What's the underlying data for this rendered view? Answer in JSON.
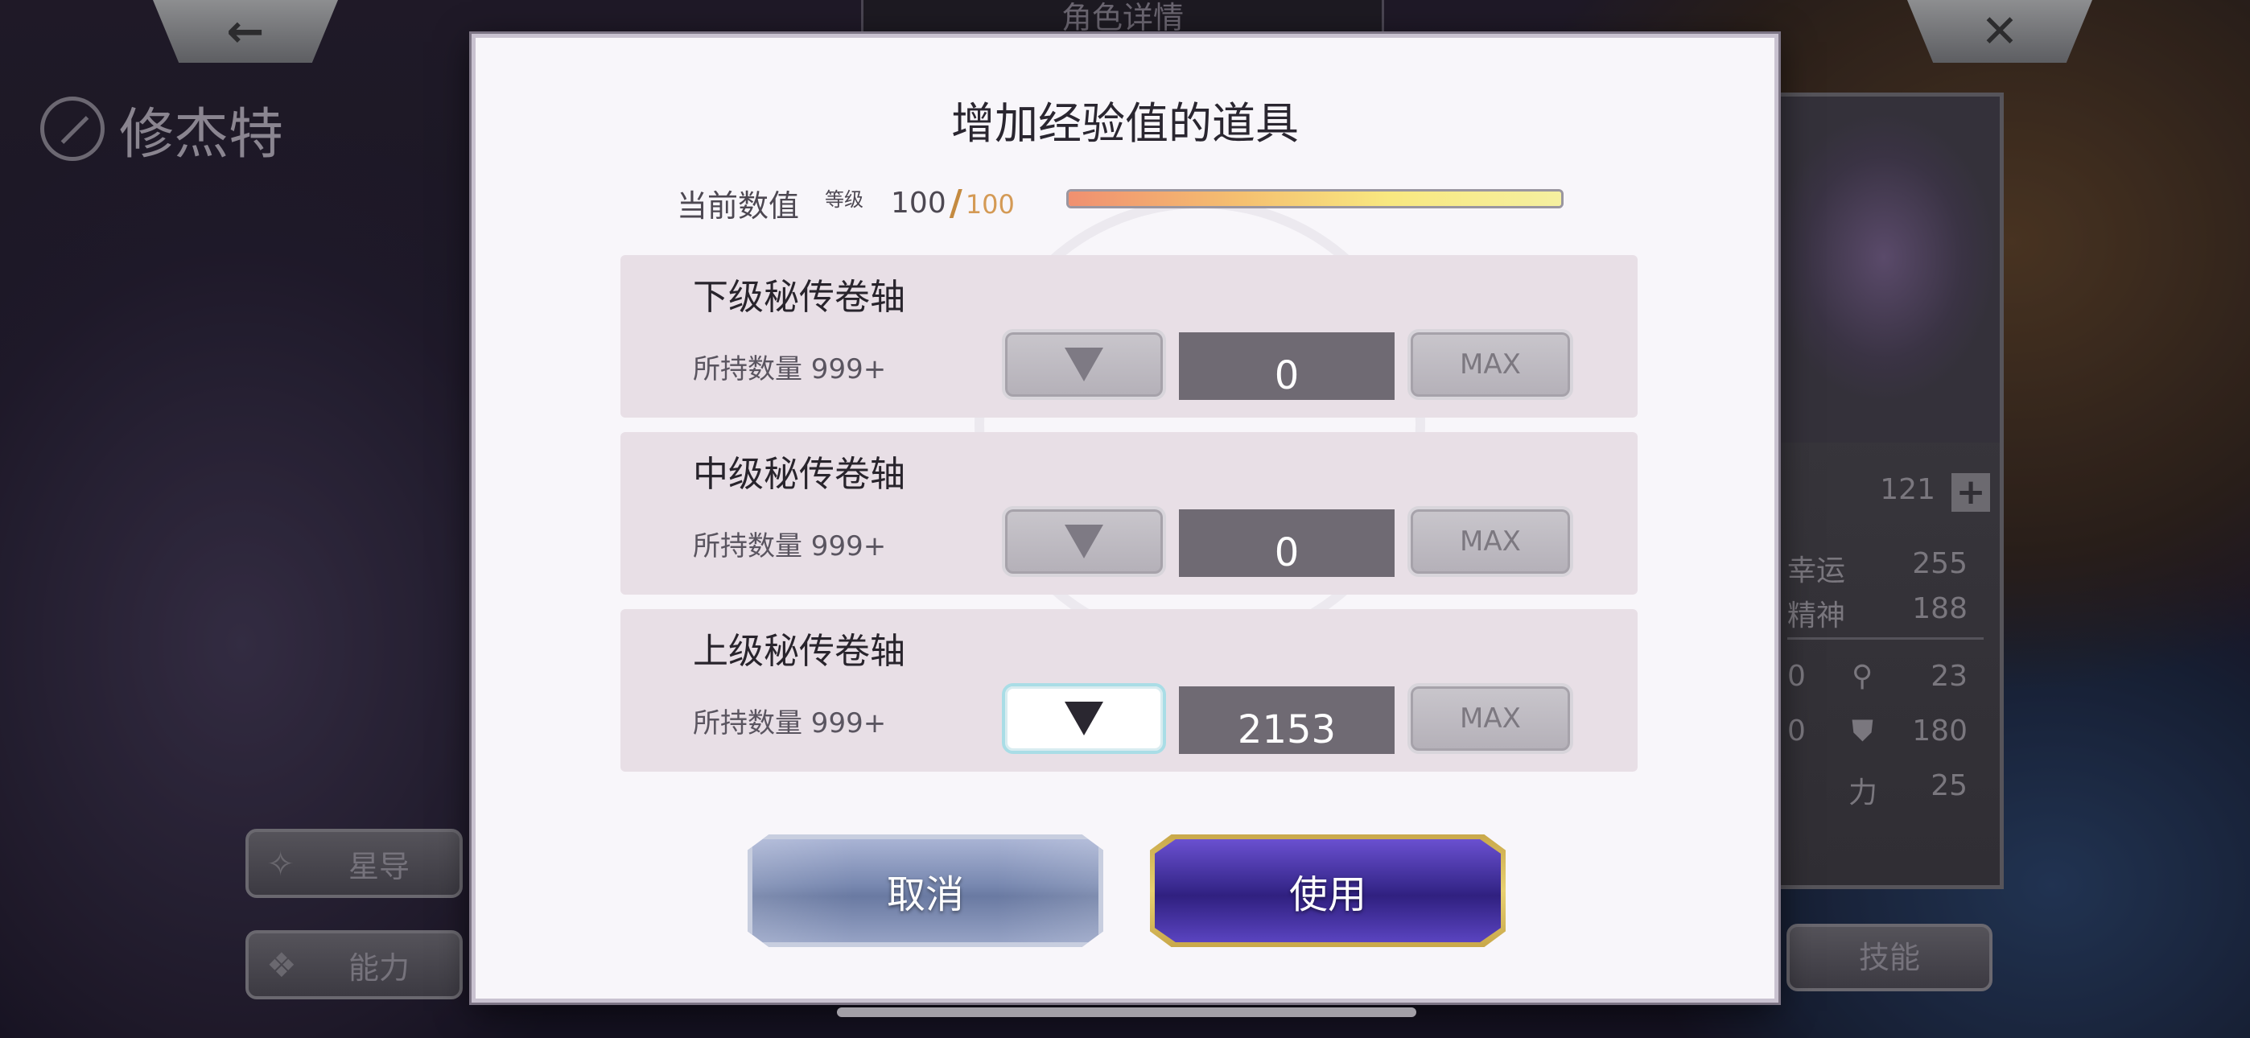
{
  "background": {
    "back_icon": "arrow-left-icon",
    "back_glyph": "←",
    "close_icon": "close-icon",
    "close_glyph": "✕",
    "top_tab_label": "角色详情",
    "character_name": "修杰特",
    "side_buttons": [
      {
        "label": "星导",
        "icon": "star-guide-icon",
        "glyph": "✧"
      },
      {
        "label": "能力",
        "icon": "ability-icon",
        "glyph": "❖"
      }
    ],
    "right_panel": {
      "level_value": "121",
      "plus_glyph": "+",
      "stats": [
        {
          "label": "幸运",
          "value": "255"
        },
        {
          "label": "精神",
          "value": "188"
        }
      ],
      "sub_stats": [
        {
          "prefix": "0",
          "icon": "key-icon",
          "glyph": "⚲",
          "value": "23"
        },
        {
          "prefix": "0",
          "icon": "shield-icon",
          "glyph": "⛊",
          "value": "180"
        },
        {
          "prefix": "力",
          "icon": "",
          "glyph": "",
          "value": "25"
        }
      ]
    },
    "skill_button": "技能"
  },
  "dialog": {
    "title": "增加经验值的道具",
    "current_label": "当前数值",
    "level_tag": "等级",
    "level_current": "100",
    "level_slash": "/",
    "level_max": "100",
    "exp_fraction": 1.0,
    "items": [
      {
        "name": "下级秘传卷轴",
        "count": "所持数量 999+",
        "quantity": "0",
        "max_label": "MAX",
        "decrease_active": false
      },
      {
        "name": "中级秘传卷轴",
        "count": "所持数量 999+",
        "quantity": "0",
        "max_label": "MAX",
        "decrease_active": false
      },
      {
        "name": "上级秘传卷轴",
        "count": "所持数量 999+",
        "quantity": "2153",
        "max_label": "MAX",
        "decrease_active": true
      }
    ],
    "cancel_label": "取消",
    "use_label": "使用"
  },
  "colors": {
    "dialog_bg": "#f8f6fa",
    "card_bg": "#e8dfe6",
    "qty_bg": "#6f6a73",
    "use_btn": "#3a2a90",
    "use_border": "#e8d070",
    "cancel_btn": "#7888b0"
  }
}
